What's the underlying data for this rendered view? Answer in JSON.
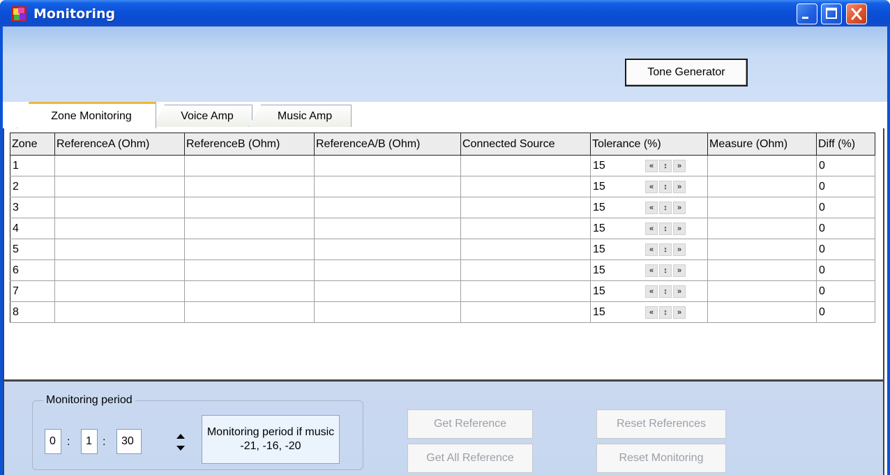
{
  "window": {
    "title": "Monitoring"
  },
  "toolbar": {
    "tone_generator_label": "Tone Generator"
  },
  "tabs": [
    "Zone Monitoring",
    "Voice Amp",
    "Music Amp"
  ],
  "table": {
    "headers": [
      "Zone",
      "ReferenceA (Ohm)",
      "ReferenceB (Ohm)",
      "ReferenceA/B (Ohm)",
      "Connected Source",
      "Tolerance (%)",
      "Measure (Ohm)",
      "Diff (%)"
    ],
    "rows": [
      {
        "zone": "1",
        "tolerance": "15",
        "diff": "0"
      },
      {
        "zone": "2",
        "tolerance": "15",
        "diff": "0"
      },
      {
        "zone": "3",
        "tolerance": "15",
        "diff": "0"
      },
      {
        "zone": "4",
        "tolerance": "15",
        "diff": "0"
      },
      {
        "zone": "5",
        "tolerance": "15",
        "diff": "0"
      },
      {
        "zone": "6",
        "tolerance": "15",
        "diff": "0"
      },
      {
        "zone": "7",
        "tolerance": "15",
        "diff": "0"
      },
      {
        "zone": "8",
        "tolerance": "15",
        "diff": "0"
      }
    ]
  },
  "monitoring_period": {
    "label": "Monitoring period",
    "hours": "0",
    "minutes": "1",
    "seconds": "30",
    "separator": ":",
    "music_button_label": "Monitoring period if music -21, -16, -20"
  },
  "actions": {
    "get_reference": "Get Reference",
    "get_all_reference": "Get All Reference",
    "reset_references": "Reset References",
    "reset_monitoring": "Reset Monitoring"
  },
  "icons": {
    "spin_first": "«",
    "spin_updown": "↕",
    "spin_last": "»"
  }
}
